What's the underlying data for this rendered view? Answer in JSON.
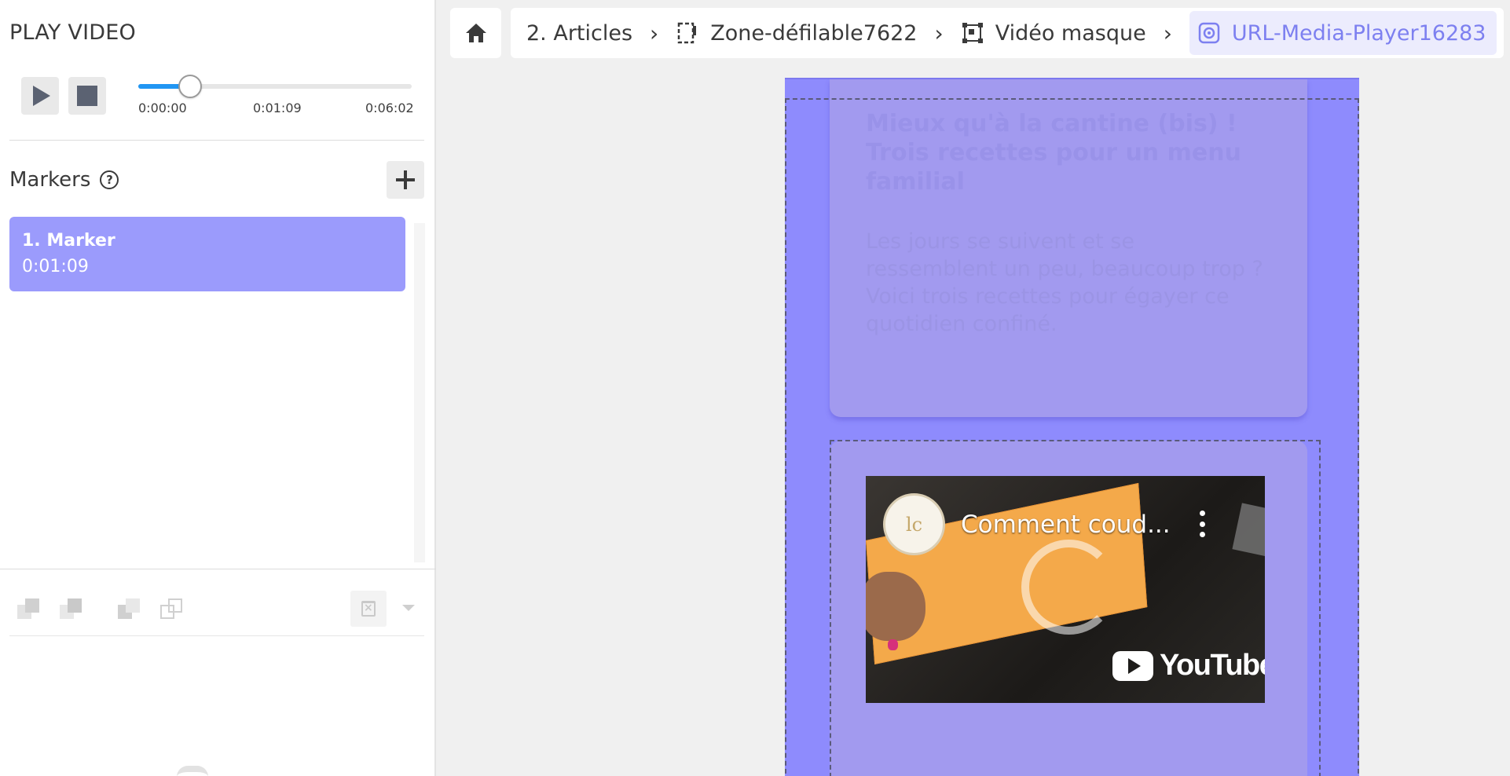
{
  "left_panel": {
    "title": "PLAY VIDEO",
    "player": {
      "progress": 0.19,
      "times": {
        "start": "0:00:00",
        "current": "0:01:09",
        "end": "0:06:02"
      }
    },
    "markers": {
      "title": "Markers",
      "help_icon": "question-circle-icon",
      "add_icon": "plus-icon",
      "items": [
        {
          "name": "1. Marker",
          "time": "0:01:09"
        }
      ]
    }
  },
  "breadcrumb": {
    "home_icon": "home-icon",
    "items": [
      {
        "label": "2. Articles",
        "icon": null
      },
      {
        "label": "Zone-défilable7622",
        "icon": "scroll-zone-icon"
      },
      {
        "label": "Vidéo masque",
        "icon": "mask-frame-icon"
      },
      {
        "label": "URL-Media-Player16283",
        "icon": "media-player-icon",
        "active": true
      }
    ]
  },
  "canvas": {
    "article": {
      "title": "Mieux qu'à la cantine (bis) ! Trois recettes pour un menu familial",
      "description": "Les jours se suivent et se ressemblent un peu, beaucoup trop ? Voici trois recettes pour égayer ce quotidien confiné."
    },
    "video": {
      "channel_avatar_text": "lc",
      "title": "Comment coud...",
      "brand": "YouTube"
    }
  },
  "colors": {
    "accent": "#9b9bfc",
    "canvas_bg": "#8e8bfd",
    "slider": "#2196f3",
    "active_crumb": "#7d80f0"
  }
}
